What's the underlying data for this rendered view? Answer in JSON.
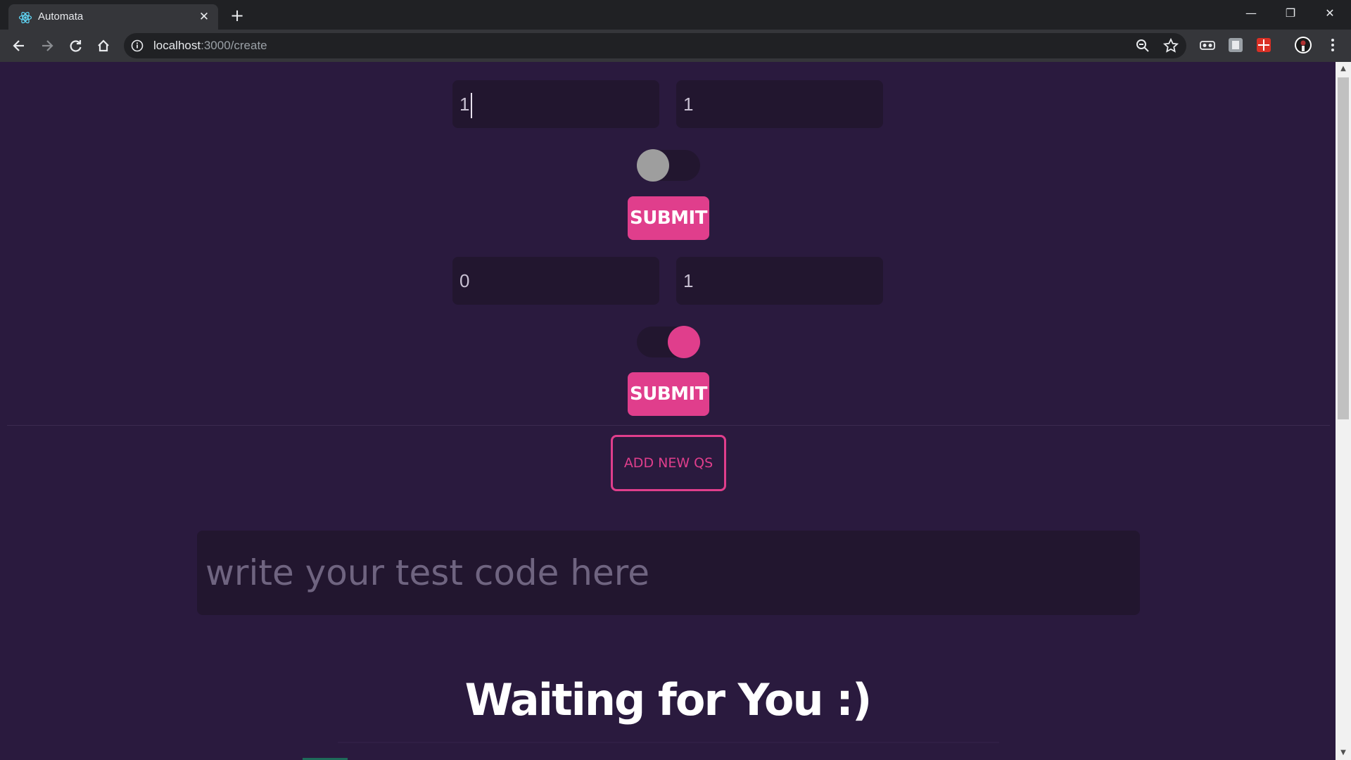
{
  "browser": {
    "tab_title": "Automata",
    "url_host": "localhost",
    "url_path": ":3000/create"
  },
  "form_blocks": [
    {
      "field_a": "1",
      "field_b": "1",
      "toggle_on": false,
      "submit_label": "SUBMIT"
    },
    {
      "field_a": "0",
      "field_b": "1",
      "toggle_on": true,
      "submit_label": "SUBMIT"
    }
  ],
  "add_button_label": "ADD NEW QS",
  "code_input": {
    "placeholder": "write your test code here",
    "value": ""
  },
  "status_heading": "Waiting for You :)",
  "colors": {
    "background": "#2a1a3e",
    "field_background": "#22162f",
    "accent": "#e03e8c",
    "toggle_off_knob": "#9e9e9e"
  }
}
